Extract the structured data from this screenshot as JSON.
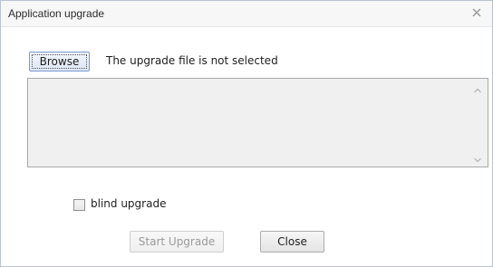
{
  "dialog": {
    "title": "Application upgrade",
    "close_icon": "close-icon"
  },
  "file": {
    "browse_label": "Browse",
    "status_text": "The upgrade file is not selected"
  },
  "log": {
    "text": "",
    "scroll_up_icon": "chevron-up-icon",
    "scroll_down_icon": "chevron-down-icon"
  },
  "options": {
    "blind_upgrade_label": "blind upgrade",
    "blind_upgrade_checked": false
  },
  "actions": {
    "start_label": "Start Upgrade",
    "start_enabled": false,
    "close_label": "Close"
  }
}
